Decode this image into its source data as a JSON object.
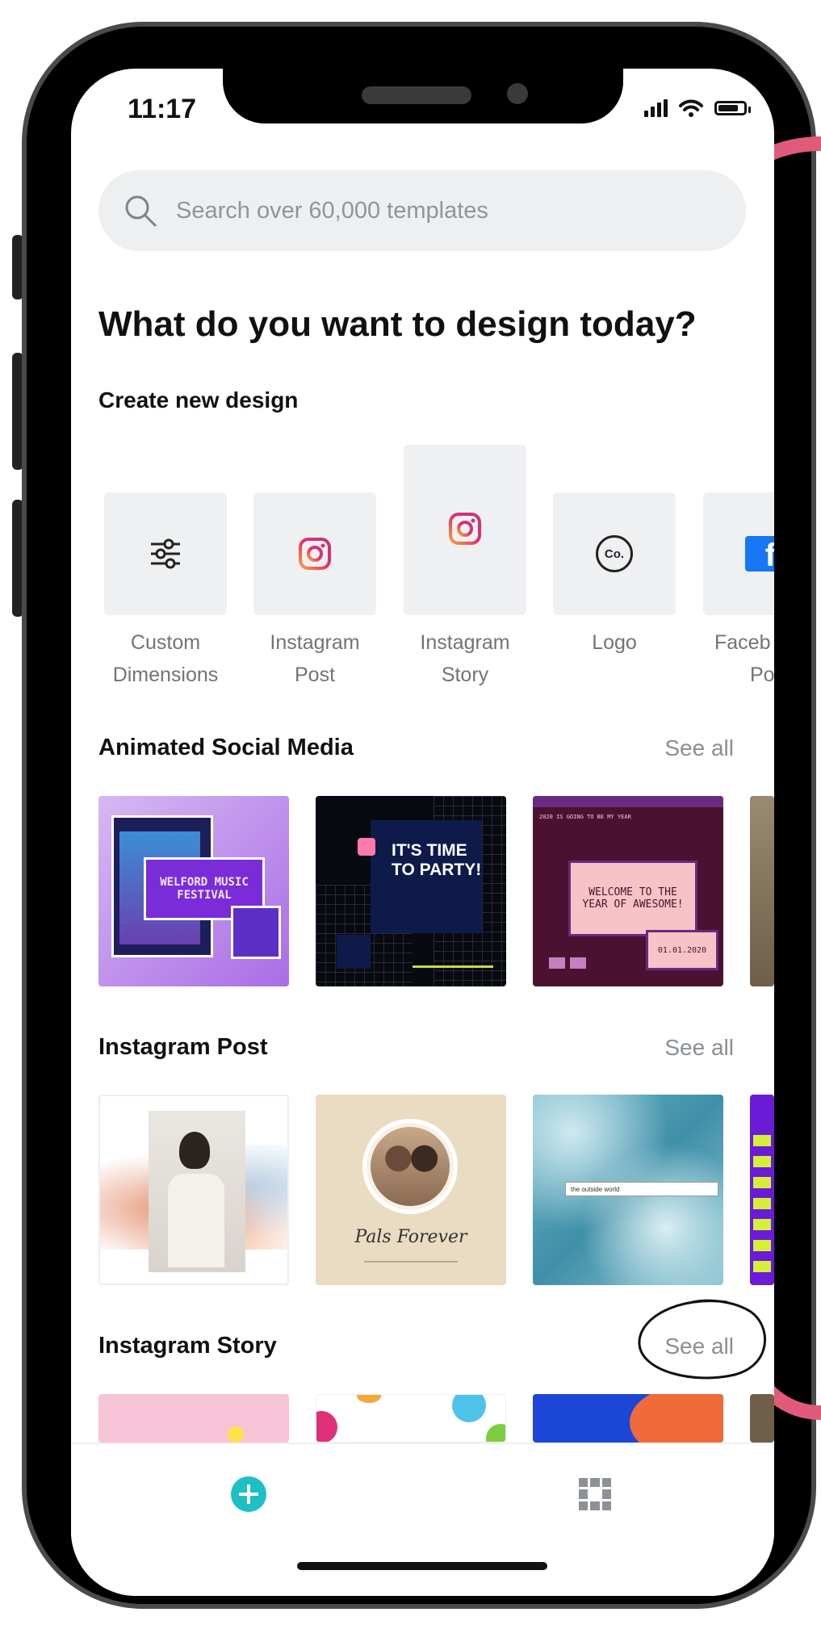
{
  "status_bar": {
    "time": "11:17"
  },
  "search": {
    "placeholder": "Search over 60,000 templates"
  },
  "page": {
    "heading": "What do you want to design today?",
    "create_heading": "Create new design"
  },
  "create_items": [
    {
      "label_line1": "Custom",
      "label_line2": "Dimensions",
      "icon": "sliders-icon"
    },
    {
      "label_line1": "Instagram",
      "label_line2": "Post",
      "icon": "instagram-icon"
    },
    {
      "label_line1": "Instagram",
      "label_line2": "Story",
      "icon": "instagram-icon"
    },
    {
      "label_line1": "Logo",
      "label_line2": "",
      "icon": "logo-co-icon",
      "badge": "Co."
    },
    {
      "label_line1": "Faceb",
      "label_line2": "Pos",
      "icon": "facebook-icon",
      "badge": "f"
    }
  ],
  "sections": [
    {
      "title": "Animated Social Media",
      "see_all": "See all",
      "thumbs": [
        {
          "text": "WELFORD MUSIC FESTIVAL"
        },
        {
          "text": "IT'S TIME TO PARTY!"
        },
        {
          "text": "WELCOME TO THE YEAR OF AWESOME!",
          "small": "2020 IS GOING TO BE MY YEAR",
          "date": "01.01.2020"
        },
        {
          "text": ""
        }
      ]
    },
    {
      "title": "Instagram Post",
      "see_all": "See all",
      "thumbs": [
        {
          "text": ""
        },
        {
          "text": "Pals Forever"
        },
        {
          "text": "the outside world"
        },
        {
          "text": ""
        }
      ]
    },
    {
      "title": "Instagram Story",
      "see_all": "See all",
      "thumbs": [
        {
          "text": ""
        },
        {
          "text": ""
        },
        {
          "text": ""
        },
        {
          "text": ""
        }
      ]
    }
  ],
  "tabbar": {
    "left_icon": "add-circle-icon",
    "right_icon": "grid-icon"
  },
  "colors": {
    "accent": "#1fbfc6",
    "annotation_pink": "#e15a7a",
    "tile_bg": "#eef0f2",
    "search_bg": "#eeeff0"
  }
}
